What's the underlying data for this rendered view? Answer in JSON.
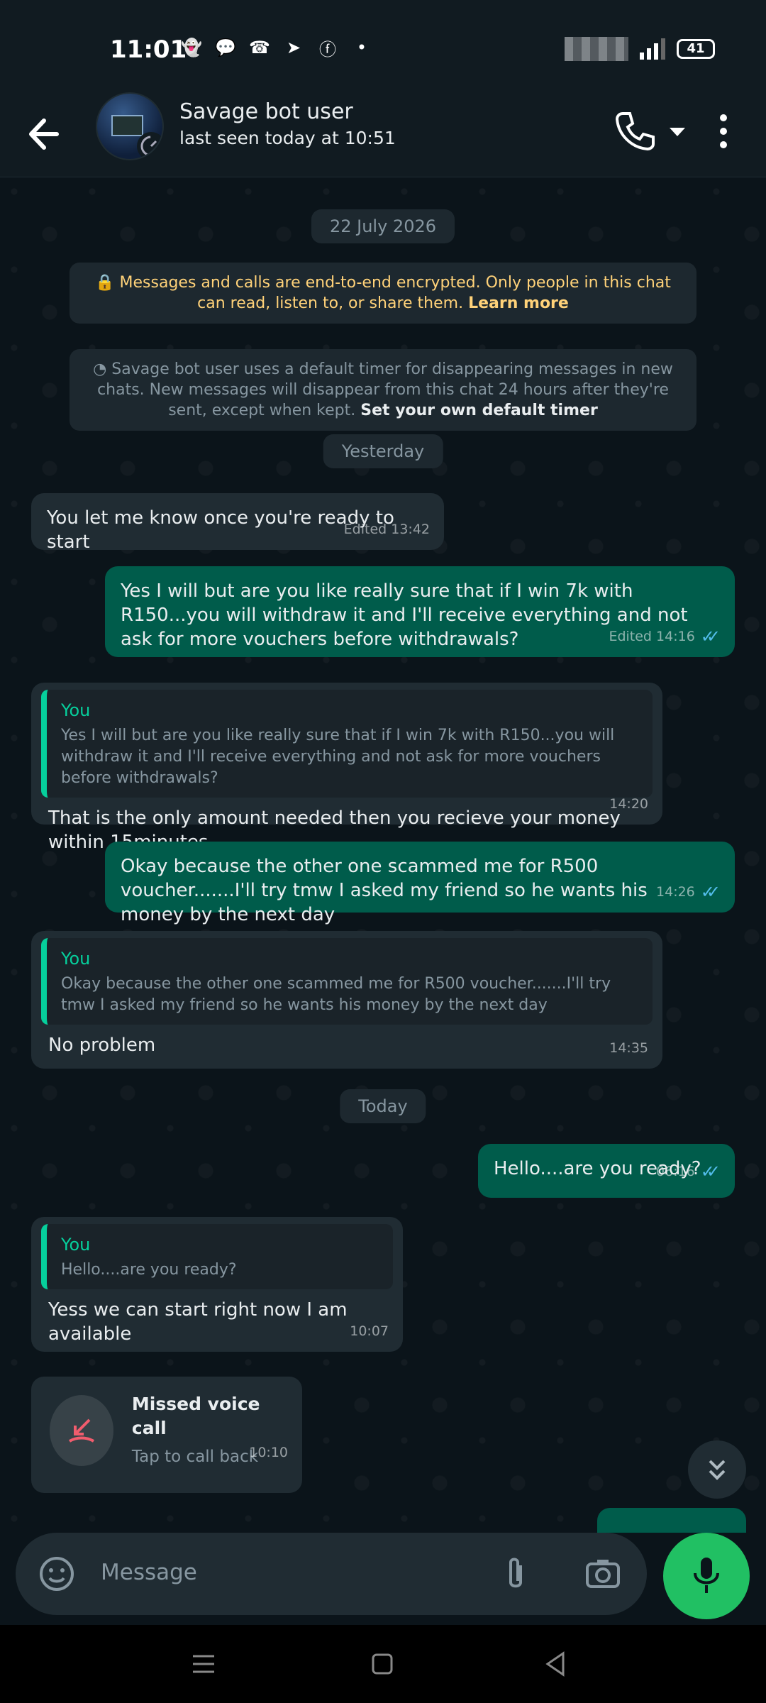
{
  "status": {
    "time": "11:01",
    "battery": "41"
  },
  "header": {
    "name": "Savage bot user",
    "last_seen": "last seen today at 10:51"
  },
  "chat": {
    "date_pill_1": "22 July 2026",
    "encryption_text": "Messages and calls are end-to-end encrypted. Only people in this chat can read, listen to, or share them.",
    "encryption_link": "Learn more",
    "timer_text": "Savage bot user uses a default timer for disappearing messages in new chats. New messages will disappear from this chat 24 hours after they're sent, except when kept.",
    "timer_link": "Set your own default timer",
    "date_pill_2": "Yesterday",
    "m1": {
      "text": "You let me know once you're ready to start",
      "meta": "Edited 13:42"
    },
    "m2": {
      "text": "Yes I will but are you like really sure that if I win 7k with R150...you will withdraw it and I'll receive everything and not ask for more vouchers before withdrawals?",
      "meta": "Edited 14:16"
    },
    "m3": {
      "quote_who": "You",
      "quote_text": "Yes I will but are you like really sure that if I win 7k with R150...you will withdraw it and I'll receive everything and not ask for more vouchers before withdrawals?",
      "text": "That is the only amount needed then you recieve your money within 15minutes",
      "meta": "14:20"
    },
    "m4": {
      "text": "Okay because the other one scammed me for R500 voucher.......I'll try tmw I asked my friend so he wants his money by the next day",
      "meta": "14:26"
    },
    "m5": {
      "quote_who": "You",
      "quote_text": "Okay because the other one scammed me for R500 voucher.......I'll try tmw I asked my friend so he wants his money by the next day",
      "text": "No problem",
      "meta": "14:35"
    },
    "date_pill_3": "Today",
    "m6": {
      "text": "Hello....are you ready?",
      "meta": "06:16"
    },
    "m7": {
      "quote_who": "You",
      "quote_text": "Hello....are you ready?",
      "text": "Yess we can start right now I am available",
      "meta": "10:07"
    },
    "m8": {
      "title": "Missed voice call",
      "sub": "Tap to call back",
      "meta": "10:10"
    }
  },
  "input": {
    "placeholder": "Message"
  },
  "colors": {
    "accent": "#21c063",
    "outgoing": "#005c4b",
    "incoming": "#202c33",
    "tick": "#53bdeb",
    "quote_bar": "#06cf9c"
  }
}
